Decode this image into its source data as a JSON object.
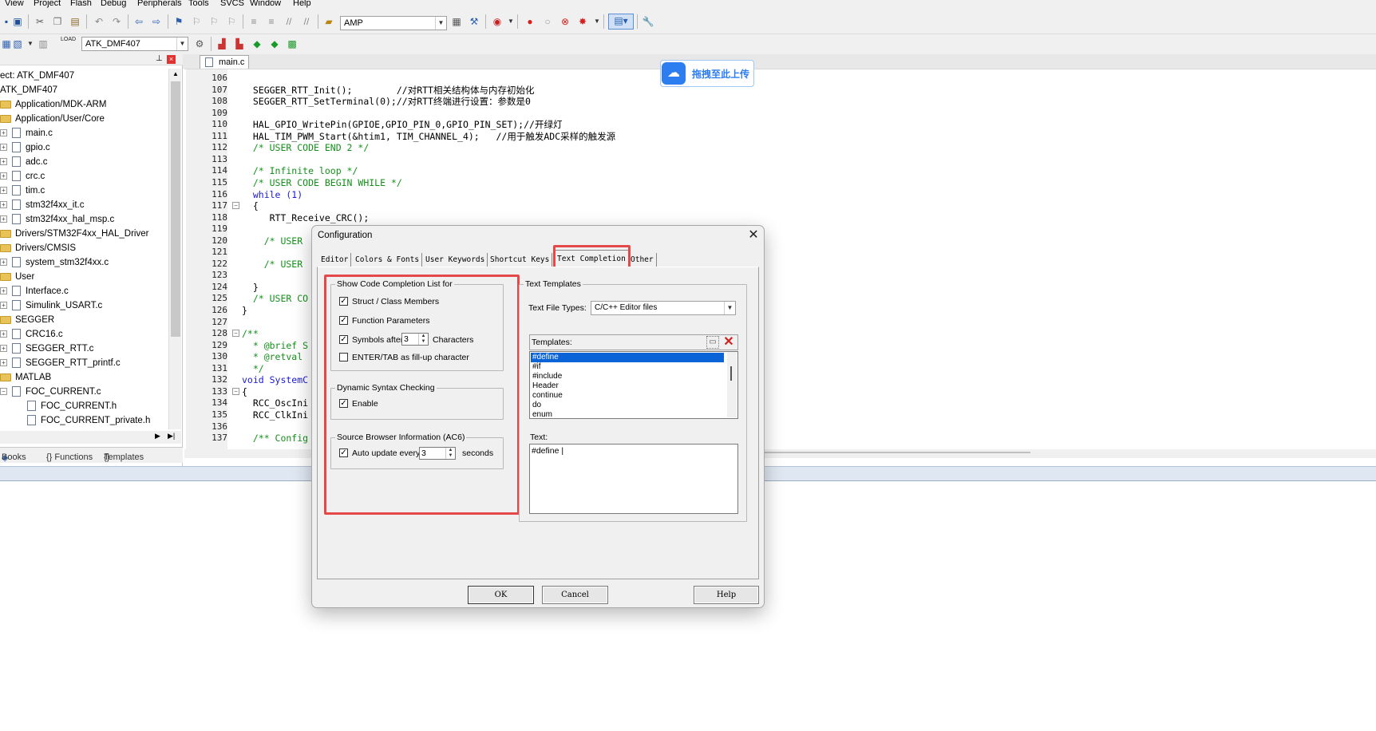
{
  "menu": [
    "View",
    "Project",
    "Flash",
    "Debug",
    "Peripherals",
    "Tools",
    "SVCS",
    "Window",
    "Help"
  ],
  "toolbar": {
    "target_combo": "AMP",
    "project_combo": "ATK_DMF407",
    "load_label": "LOAD"
  },
  "project_panel": {
    "items": [
      {
        "text": "ect: ATK_DMF407",
        "icon": "root"
      },
      {
        "text": "ATK_DMF407",
        "icon": "target"
      },
      {
        "text": "Application/MDK-ARM",
        "icon": "folder-icon"
      },
      {
        "text": "Application/User/Core",
        "icon": "folder-icon"
      },
      {
        "text": "main.c",
        "icon": "file-icon"
      },
      {
        "text": "gpio.c",
        "icon": "file-icon"
      },
      {
        "text": "adc.c",
        "icon": "file-icon"
      },
      {
        "text": "crc.c",
        "icon": "file-icon"
      },
      {
        "text": "tim.c",
        "icon": "file-icon"
      },
      {
        "text": "stm32f4xx_it.c",
        "icon": "file-icon"
      },
      {
        "text": "stm32f4xx_hal_msp.c",
        "icon": "file-icon"
      },
      {
        "text": "Drivers/STM32F4xx_HAL_Driver",
        "icon": "folder-icon"
      },
      {
        "text": "Drivers/CMSIS",
        "icon": "folder-icon"
      },
      {
        "text": "system_stm32f4xx.c",
        "icon": "file-icon"
      },
      {
        "text": "User",
        "icon": "folder-icon"
      },
      {
        "text": "Interface.c",
        "icon": "file-icon"
      },
      {
        "text": "Simulink_USART.c",
        "icon": "file-icon"
      },
      {
        "text": "SEGGER",
        "icon": "folder-icon"
      },
      {
        "text": "CRC16.c",
        "icon": "file-icon"
      },
      {
        "text": "SEGGER_RTT.c",
        "icon": "file-icon"
      },
      {
        "text": "SEGGER_RTT_printf.c",
        "icon": "file-icon"
      },
      {
        "text": "MATLAB",
        "icon": "folder-icon"
      },
      {
        "text": "FOC_CURRENT.c",
        "icon": "file-icon"
      },
      {
        "text": "FOC_CURRENT.h",
        "icon": "file-icon"
      },
      {
        "text": "FOC_CURRENT_private.h",
        "icon": "file-icon"
      }
    ],
    "bottom_tabs": [
      "Books",
      "{} Functions",
      "Templates"
    ]
  },
  "editor": {
    "tab": "main.c",
    "lines": [
      {
        "n": "106",
        "text": ""
      },
      {
        "n": "107",
        "text": "  SEGGER_RTT_Init();        //对RTT相关结构体与内存初始化"
      },
      {
        "n": "108",
        "text": "  SEGGER_RTT_SetTerminal(0);//对RTT终端进行设置：参数是0"
      },
      {
        "n": "109",
        "text": ""
      },
      {
        "n": "110",
        "text": "  HAL_GPIO_WritePin(GPIOE,GPIO_PIN_0,GPIO_PIN_SET);//开绿灯"
      },
      {
        "n": "111",
        "text": "  HAL_TIM_PWM_Start(&htim1, TIM_CHANNEL_4);   //用于触发ADC采样的触发源"
      },
      {
        "n": "112",
        "text": "  /* USER CODE END 2 */"
      },
      {
        "n": "113",
        "text": ""
      },
      {
        "n": "114",
        "text": "  /* Infinite loop */"
      },
      {
        "n": "115",
        "text": "  /* USER CODE BEGIN WHILE */"
      },
      {
        "n": "116",
        "text": "  while (1)"
      },
      {
        "n": "117",
        "text": "  {"
      },
      {
        "n": "118",
        "text": "     RTT_Receive_CRC();"
      },
      {
        "n": "119",
        "text": ""
      },
      {
        "n": "120",
        "text": "    /* USER"
      },
      {
        "n": "121",
        "text": ""
      },
      {
        "n": "122",
        "text": "    /* USER"
      },
      {
        "n": "123",
        "text": ""
      },
      {
        "n": "124",
        "text": "  }"
      },
      {
        "n": "125",
        "text": "  /* USER CO"
      },
      {
        "n": "126",
        "text": "}"
      },
      {
        "n": "127",
        "text": ""
      },
      {
        "n": "128",
        "text": "/**"
      },
      {
        "n": "129",
        "text": "  * @brief S"
      },
      {
        "n": "130",
        "text": "  * @retval"
      },
      {
        "n": "131",
        "text": "  */"
      },
      {
        "n": "132",
        "text": "void SystemC"
      },
      {
        "n": "133",
        "text": "{"
      },
      {
        "n": "134",
        "text": "  RCC_OscIni"
      },
      {
        "n": "135",
        "text": "  RCC_ClkIni"
      },
      {
        "n": "136",
        "text": ""
      },
      {
        "n": "137",
        "text": "  /** Config"
      }
    ]
  },
  "upload_widget": {
    "label": "拖拽至此上传"
  },
  "dialog": {
    "title": "Configuration",
    "tabs": [
      "Editor",
      "Colors & Fonts",
      "User Keywords",
      "Shortcut Keys",
      "Text Completion",
      "Other"
    ],
    "active_tab": "Text Completion",
    "completion_group": {
      "title": "Show Code Completion List for",
      "struct_members": "Struct / Class Members",
      "function_params": "Function Parameters",
      "symbols_after": "Symbols after",
      "symbols_value": "3",
      "characters": "Characters",
      "enter_tab": "ENTER/TAB as fill-up character"
    },
    "syntax_group": {
      "title": "Dynamic Syntax Checking",
      "enable": "Enable"
    },
    "browser_group": {
      "title": "Source Browser Information (AC6)",
      "auto_update": "Auto update every",
      "value": "3",
      "seconds": "seconds"
    },
    "templates_group": {
      "title": "Text Templates",
      "file_types_label": "Text File Types:",
      "file_types_value": "C/C++ Editor files",
      "templates_label": "Templates:",
      "templates": [
        "#define",
        "#if",
        "#include",
        "Header",
        "continue",
        "do",
        "enum"
      ],
      "selected_template": "#define",
      "text_label": "Text:",
      "text_value": "#define |"
    },
    "buttons": {
      "ok": "OK",
      "cancel": "Cancel",
      "help": "Help"
    },
    "highlight_color": "#e54848"
  }
}
